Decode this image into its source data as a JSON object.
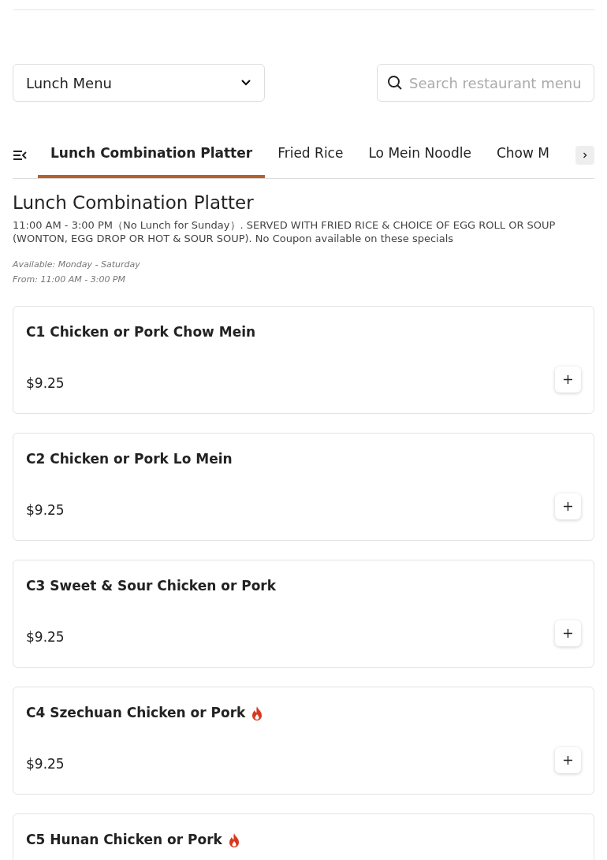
{
  "menu_select": {
    "value": "Lunch Menu"
  },
  "search": {
    "placeholder": "Search restaurant menu"
  },
  "tabs": [
    {
      "label": "Lunch Combination Platter",
      "selected": true
    },
    {
      "label": "Fried Rice",
      "selected": false
    },
    {
      "label": "Lo Mein Noodle",
      "selected": false
    },
    {
      "label": "Chow M",
      "selected": false
    }
  ],
  "section": {
    "title": "Lunch Combination Platter",
    "description": "11:00 AM - 3:00 PM（No Lunch for Sunday）. SERVED WITH FRIED RICE & CHOICE OF EGG ROLL OR SOUP (WONTON, EGG DROP OR HOT & SOUR SOUP). No Coupon available on these specials",
    "availability": "Available: Monday - Saturday",
    "hours": "From: 11:00 AM - 3:00 PM"
  },
  "items": [
    {
      "name": "C1 Chicken or Pork Chow Mein",
      "price": "$9.25",
      "spicy": false
    },
    {
      "name": "C2 Chicken or Pork Lo Mein",
      "price": "$9.25",
      "spicy": false
    },
    {
      "name": "C3 Sweet & Sour Chicken or Pork",
      "price": "$9.25",
      "spicy": false
    },
    {
      "name": "C4 Szechuan Chicken or Pork",
      "price": "$9.25",
      "spicy": true
    },
    {
      "name": "C5 Hunan Chicken or Pork",
      "spicy": true
    }
  ]
}
